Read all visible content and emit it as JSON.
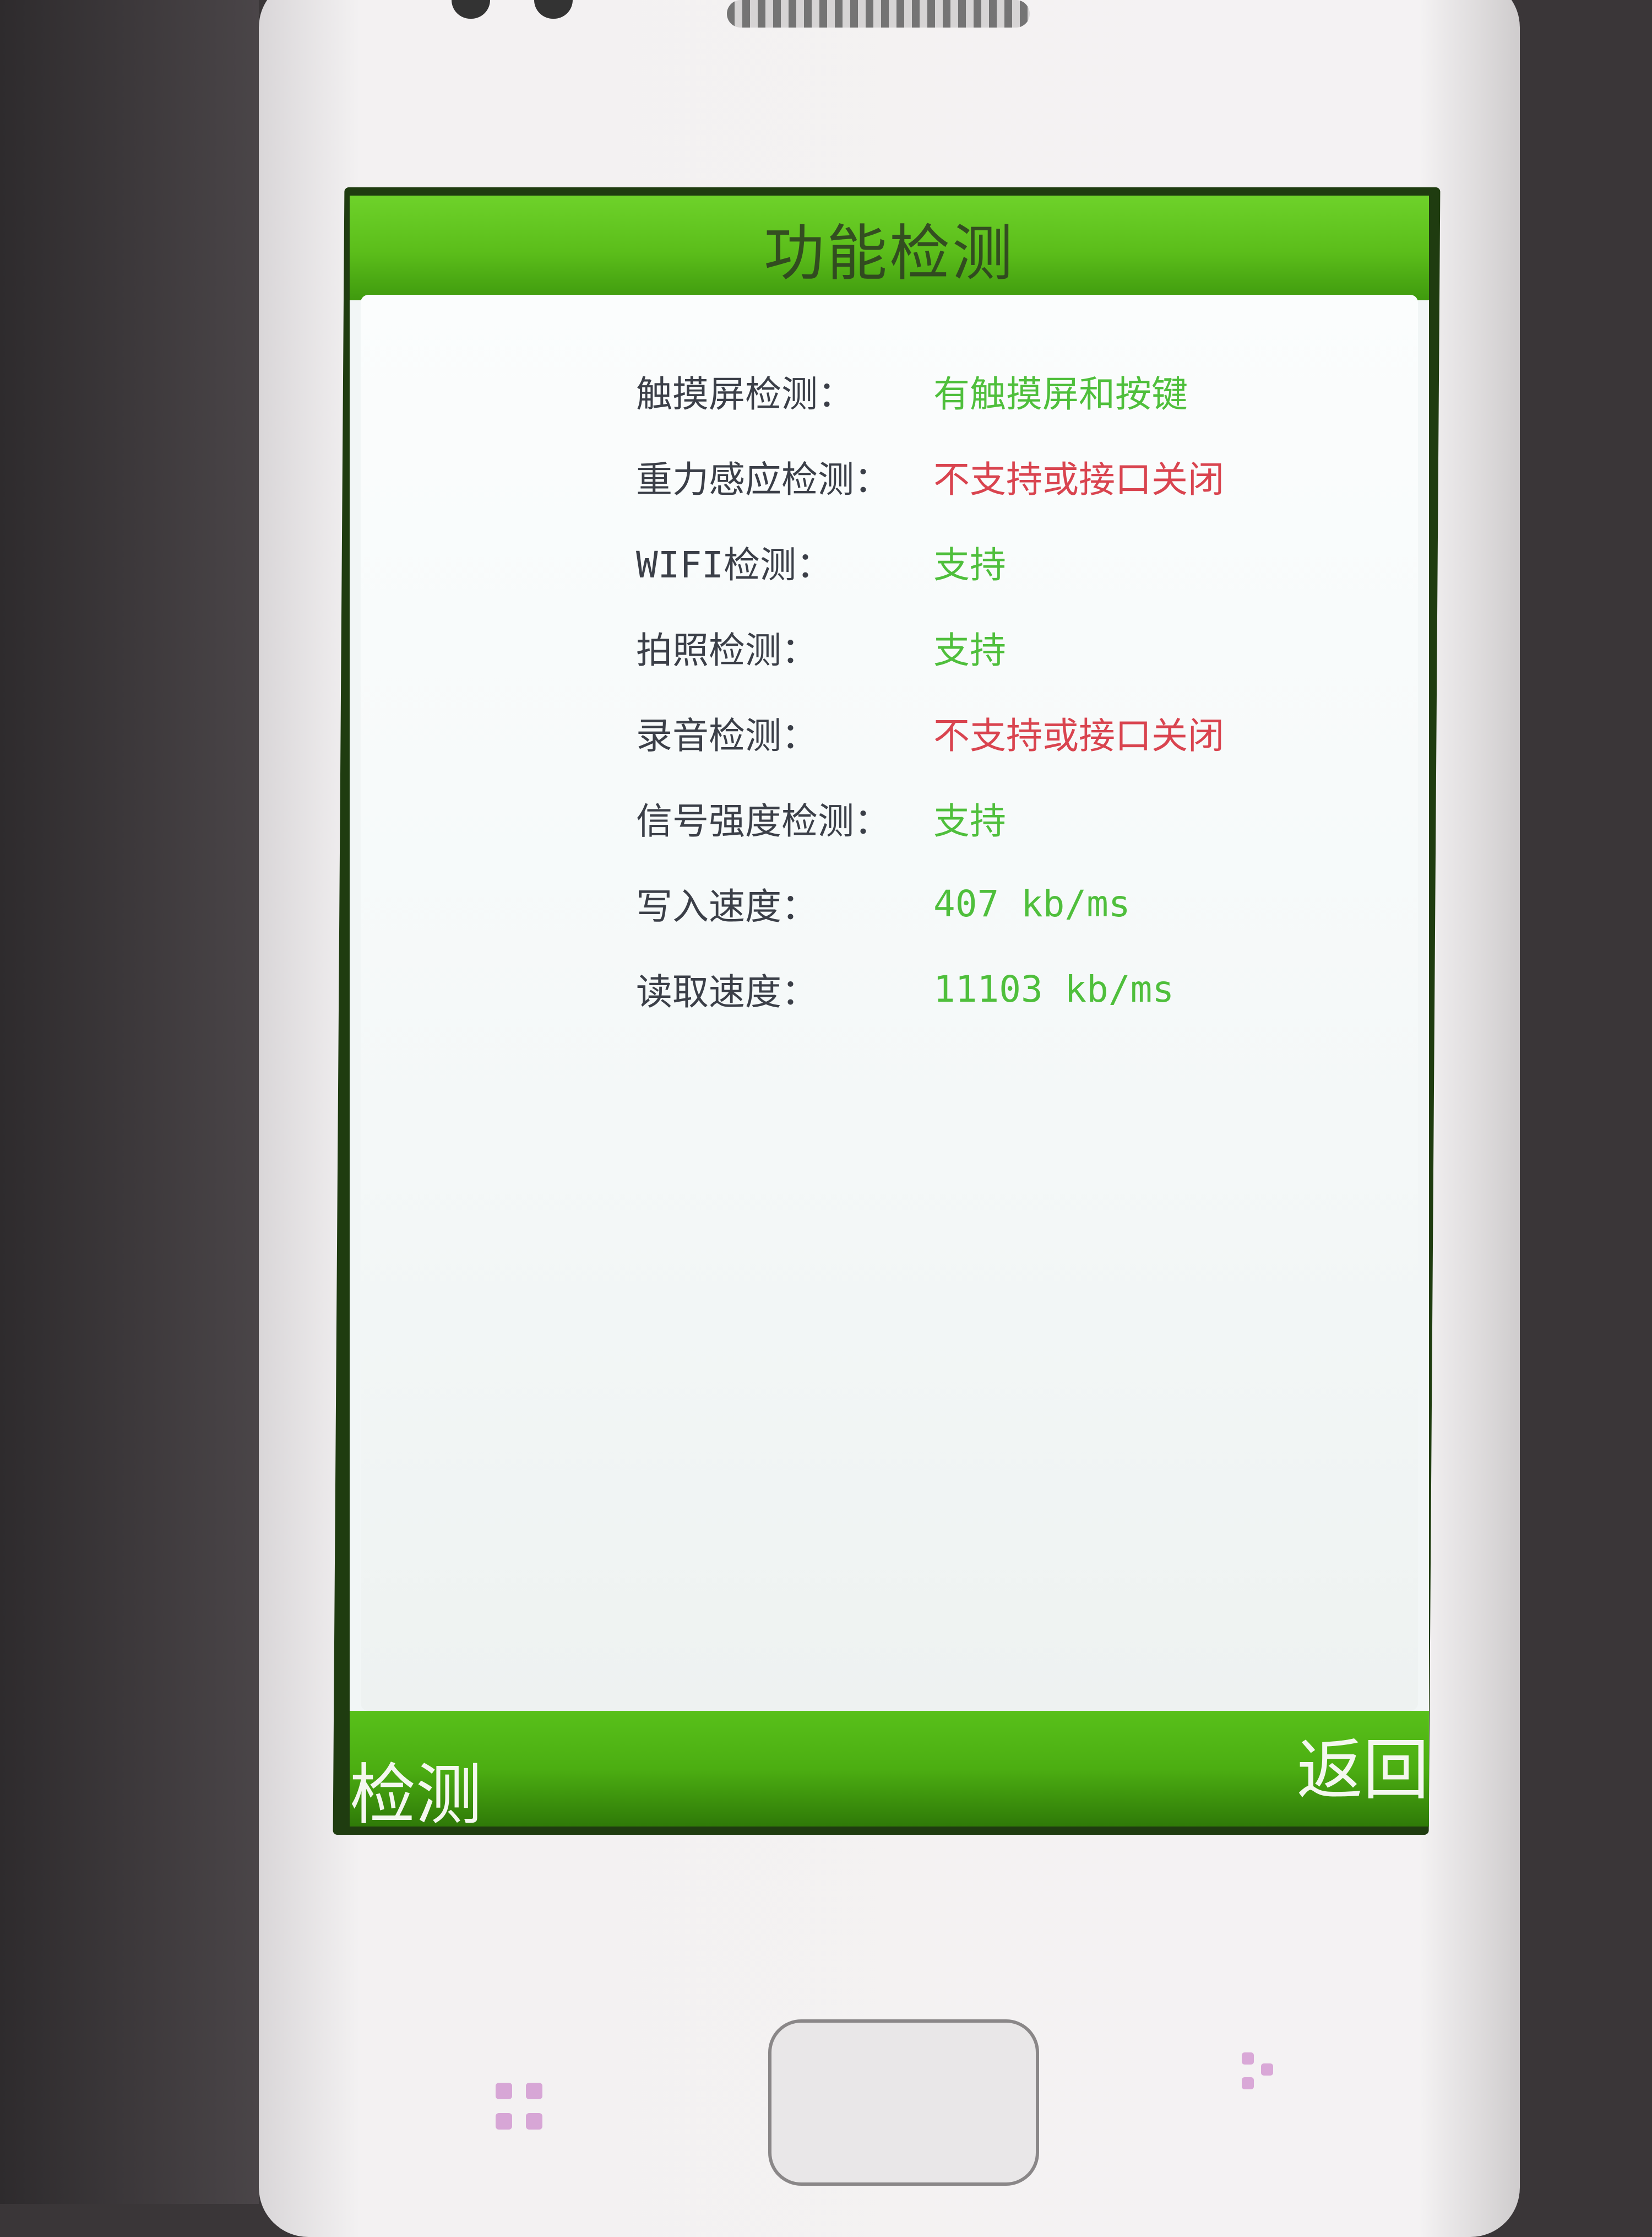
{
  "app": {
    "title": "功能检测"
  },
  "results": [
    {
      "label": "触摸屏检测：",
      "value": "有触摸屏和按键",
      "status": "ok"
    },
    {
      "label": "重力感应检测：",
      "value": "不支持或接口关闭",
      "status": "fail"
    },
    {
      "label": "WIFI检测：",
      "value": "支持",
      "status": "ok"
    },
    {
      "label": "拍照检测：",
      "value": "支持",
      "status": "ok"
    },
    {
      "label": "录音检测：",
      "value": "不支持或接口关闭",
      "status": "fail"
    },
    {
      "label": "信号强度检测：",
      "value": "支持",
      "status": "ok"
    },
    {
      "label": "写入速度：",
      "value": "407 kb/ms",
      "status": "ok"
    },
    {
      "label": "读取速度：",
      "value": "11103 kb/ms",
      "status": "ok"
    }
  ],
  "softkeys": {
    "left": "检测",
    "right": "返回"
  },
  "colors": {
    "ok": "#4fbf3c",
    "fail": "#d9444f",
    "accent": "#5bbd1a"
  },
  "icons": {
    "menu_key": "grid-icon",
    "back_key": "back-icon"
  }
}
